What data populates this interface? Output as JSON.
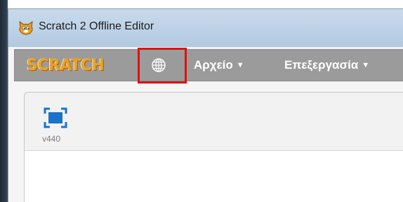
{
  "window": {
    "title": "Scratch 2 Offline Editor",
    "app_icon": "scratch-cat-icon"
  },
  "menubar": {
    "logo_text": "SCRATCH",
    "globe_icon": "globe-icon",
    "items": [
      {
        "label": "Αρχείο",
        "arrow": "▼"
      },
      {
        "label": "Επεξεργασία",
        "arrow": "▼"
      }
    ],
    "highlight_color": "#e01010"
  },
  "toolbar": {
    "fullscreen_icon": "fullscreen-icon",
    "version": "v440"
  }
}
